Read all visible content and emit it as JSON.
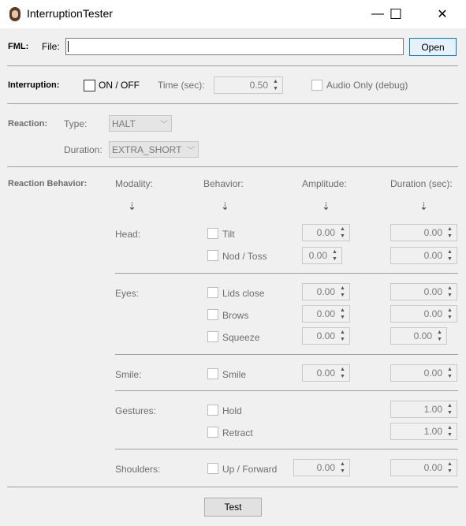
{
  "window": {
    "title": "InterruptionTester",
    "minimize": "—",
    "maximize": "☐",
    "close": "✕"
  },
  "fml": {
    "label": "FML:",
    "file_label": "File:",
    "file_value": "",
    "open_label": "Open"
  },
  "interruption": {
    "label": "Interruption:",
    "toggle_label": "ON / OFF",
    "time_label": "Time (sec):",
    "time_value": "0.50",
    "audio_label": "Audio Only (debug)"
  },
  "reaction": {
    "label": "Reaction:",
    "type_label": "Type:",
    "type_value": "HALT",
    "duration_label": "Duration:",
    "duration_value": "EXTRA_SHORT"
  },
  "behavior": {
    "label": "Reaction Behavior:",
    "headers": {
      "modality": "Modality:",
      "behavior": "Behavior:",
      "amplitude": "Amplitude:",
      "duration": "Duration (sec):"
    },
    "arrow": "⇣",
    "groups": {
      "head": "Head:",
      "eyes": "Eyes:",
      "smile": "Smile:",
      "gestures": "Gestures:",
      "shoulders": "Shoulders:"
    },
    "items": {
      "tilt": {
        "label": "Tilt",
        "amp": "0.00",
        "dur": "0.00"
      },
      "nod": {
        "label": "Nod / Toss",
        "amp": "0.00",
        "dur": "0.00"
      },
      "lids": {
        "label": "Lids close",
        "amp": "0.00",
        "dur": "0.00"
      },
      "brows": {
        "label": "Brows",
        "amp": "0.00",
        "dur": "0.00"
      },
      "squeeze": {
        "label": "Squeeze",
        "amp": "0.00",
        "dur": "0.00"
      },
      "smile": {
        "label": "Smile",
        "amp": "0.00",
        "dur": "0.00"
      },
      "hold": {
        "label": "Hold",
        "dur": "1.00"
      },
      "retract": {
        "label": "Retract",
        "dur": "1.00"
      },
      "up": {
        "label": "Up / Forward",
        "amp": "0.00",
        "dur": "0.00"
      }
    }
  },
  "test_label": "Test"
}
